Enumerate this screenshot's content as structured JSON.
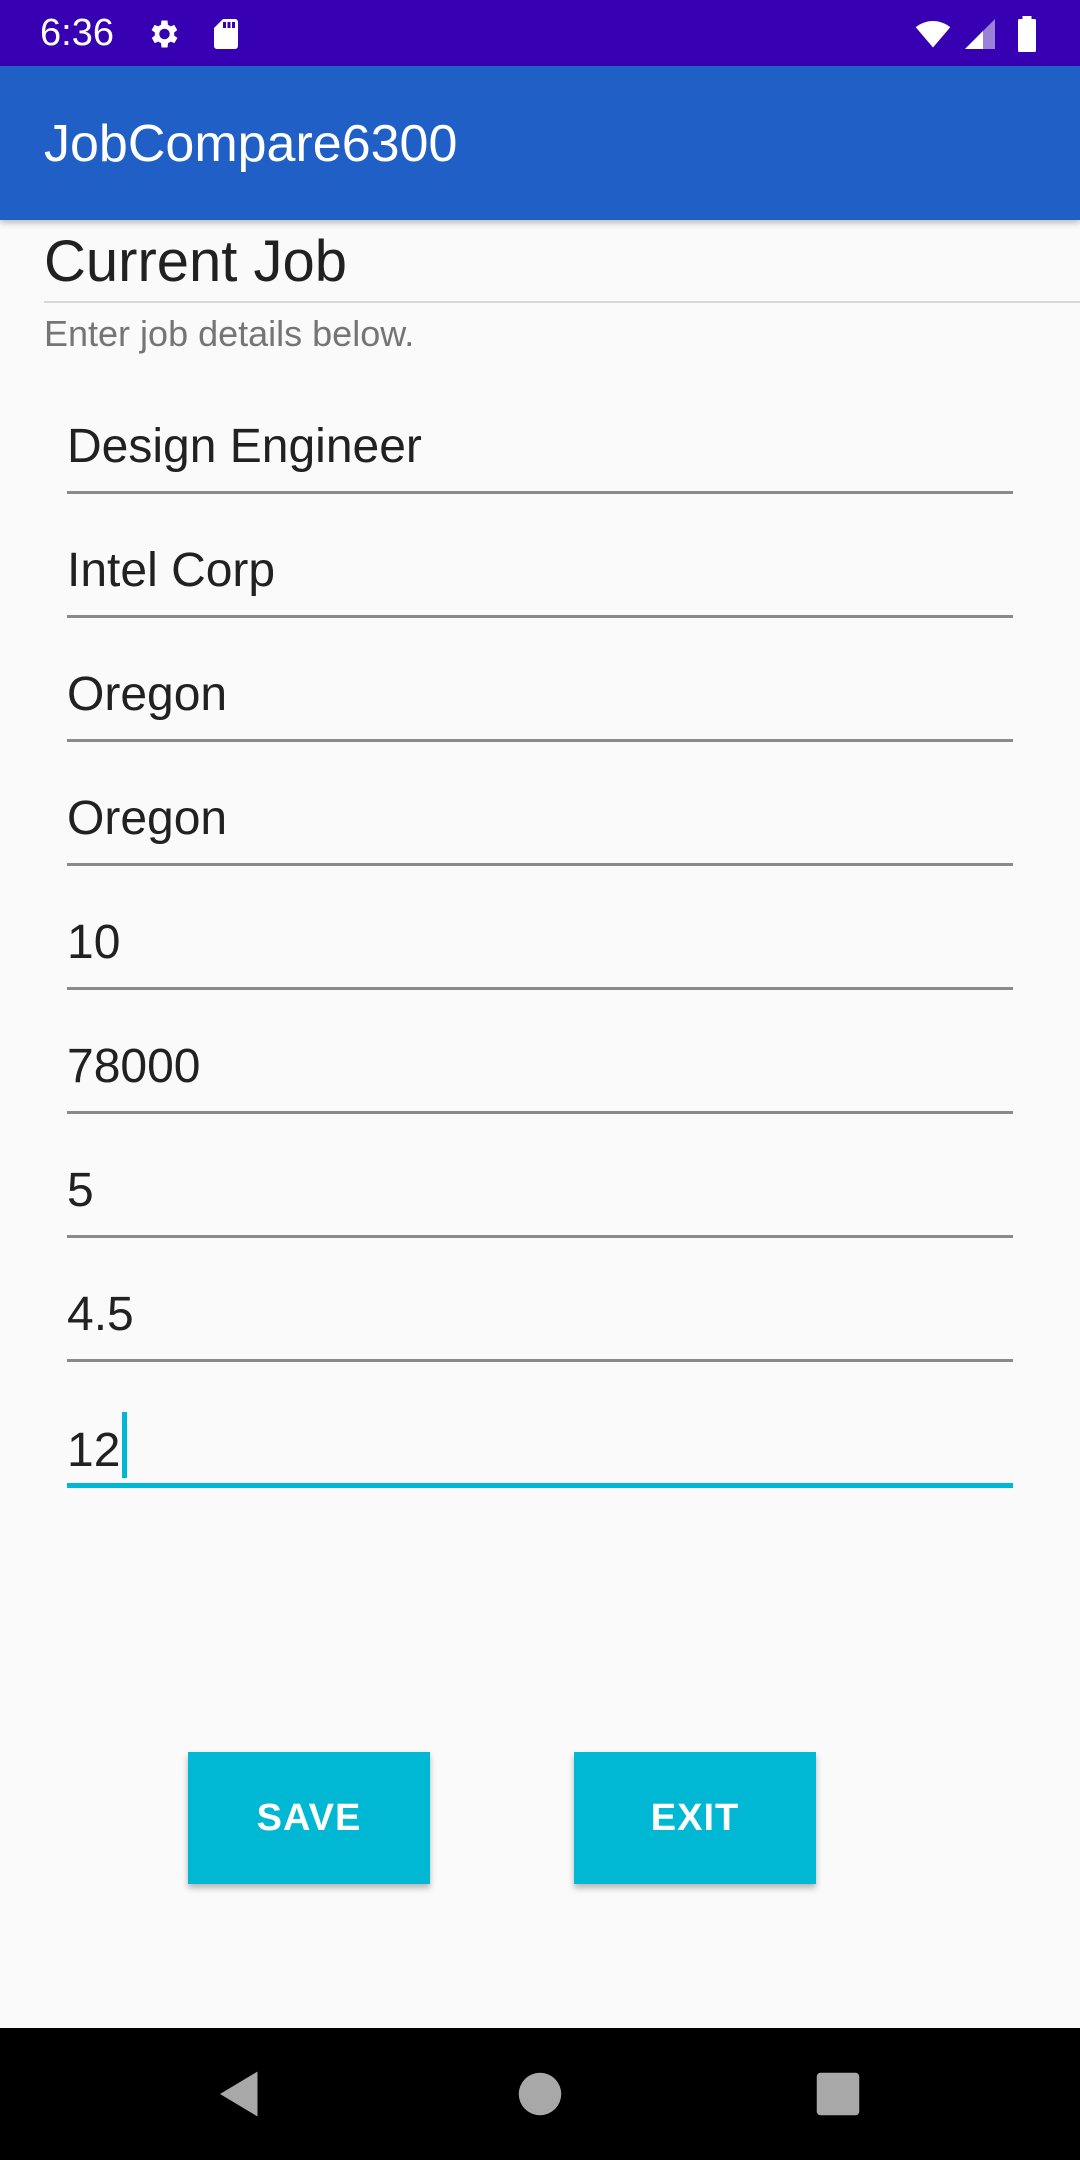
{
  "status_bar": {
    "time": "6:36",
    "icons": [
      "gear-icon",
      "sd-card-icon",
      "wifi-icon",
      "signal-icon",
      "battery-icon"
    ],
    "background_color": "#3700b3"
  },
  "app_bar": {
    "title": "JobCompare6300",
    "background_color": "#1f5fc6"
  },
  "section": {
    "title": "Current Job",
    "subtitle": "Enter job details below."
  },
  "fields": [
    {
      "value": "Design Engineer"
    },
    {
      "value": "Intel Corp"
    },
    {
      "value": "Oregon"
    },
    {
      "value": "Oregon"
    },
    {
      "value": "10"
    },
    {
      "value": "78000"
    },
    {
      "value": "5"
    },
    {
      "value": "4.5"
    },
    {
      "value": "12",
      "focused": true
    }
  ],
  "buttons": {
    "save_label": "SAVE",
    "exit_label": "EXIT",
    "accent_color": "#00b8d4"
  },
  "nav_bar": {
    "icons": [
      "back-icon",
      "home-icon",
      "recents-icon"
    ]
  }
}
